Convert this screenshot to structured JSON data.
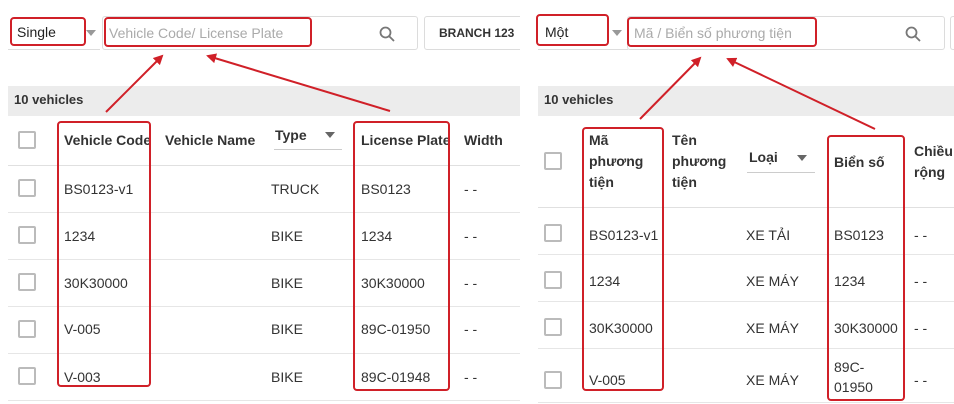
{
  "left": {
    "mode_select": "Single",
    "search_placeholder": "Vehicle Code/ License Plate",
    "branch_button": "BRANCH 123",
    "count_label": "10 vehicles",
    "columns": {
      "vehicle_code": "Vehicle Code",
      "vehicle_name": "Vehicle Name",
      "type": "Type",
      "license_plate": "License Plate",
      "width": "Width"
    },
    "rows": [
      {
        "code": "BS0123-v1",
        "name": "",
        "type": "TRUCK",
        "plate": "BS0123",
        "width": "- -"
      },
      {
        "code": "1234",
        "name": "",
        "type": "BIKE",
        "plate": "1234",
        "width": "- -"
      },
      {
        "code": "30K30000",
        "name": "",
        "type": "BIKE",
        "plate": "30K30000",
        "width": "- -"
      },
      {
        "code": "V-005",
        "name": "",
        "type": "BIKE",
        "plate": "89C-01950",
        "width": "- -"
      },
      {
        "code": "V-003",
        "name": "",
        "type": "BIKE",
        "plate": "89C-01948",
        "width": "- -"
      }
    ]
  },
  "right": {
    "mode_select": "Một",
    "search_placeholder": "Mã / Biển số phương tiện",
    "count_label": "10 vehicles",
    "columns": {
      "vehicle_code_l1": "Mã",
      "vehicle_code_l2": "phương",
      "vehicle_code_l3": "tiện",
      "vehicle_name_l1": "Tên",
      "vehicle_name_l2": "phương",
      "vehicle_name_l3": "tiện",
      "type": "Loại",
      "license_plate": "Biển số",
      "width_l1": "Chiều",
      "width_l2": "rộng"
    },
    "rows": [
      {
        "code": "BS0123-v1",
        "type": "XE TẢI",
        "plate_l1": "BS0123",
        "plate_l2": "",
        "width": "- -"
      },
      {
        "code": "1234",
        "type": "XE MÁY",
        "plate_l1": "1234",
        "plate_l2": "",
        "width": "- -"
      },
      {
        "code": "30K30000",
        "type": "XE MÁY",
        "plate_l1": "30K30000",
        "plate_l2": "",
        "width": "- -"
      },
      {
        "code": "V-005",
        "type": "XE MÁY",
        "plate_l1": "89C-",
        "plate_l2": "01950",
        "width": "- -"
      }
    ]
  },
  "colors": {
    "annotation": "#d02028",
    "count_bar_bg": "#ececec"
  }
}
